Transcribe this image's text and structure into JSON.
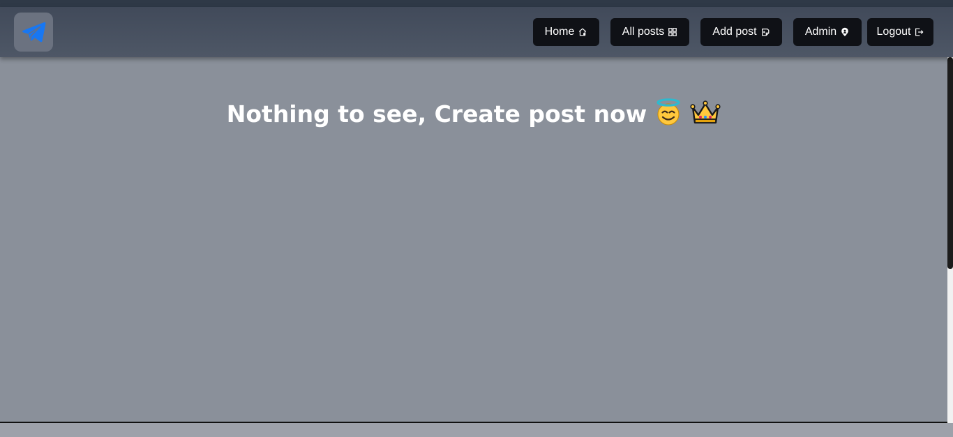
{
  "navbar": {
    "logo_icon": "paper-plane-icon",
    "items": [
      {
        "label": "Home",
        "icon": "home-icon"
      },
      {
        "label": "All posts",
        "icon": "grid-icon"
      },
      {
        "label": "Add post",
        "icon": "add-note-icon"
      },
      {
        "label": "Admin",
        "icon": "user-pin-icon"
      },
      {
        "label": "Logout",
        "icon": "logout-icon"
      }
    ]
  },
  "main": {
    "empty_message": "Nothing to see, Create post now",
    "emojis": [
      "smiling-face-with-halo-icon",
      "crown-icon"
    ]
  },
  "colors": {
    "accent": "#1877f2",
    "button_bg": "#0f1116",
    "navbar_bg": "#4b5463",
    "page_bg": "#8a909a"
  }
}
